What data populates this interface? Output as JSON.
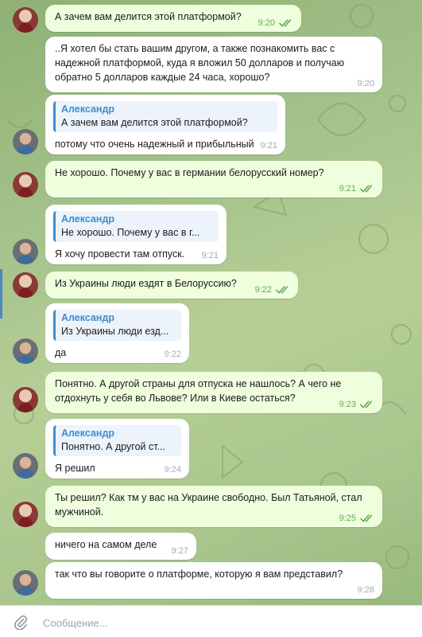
{
  "composer": {
    "placeholder": "Сообщение..."
  },
  "colors": {
    "accent": "#3d8ed0",
    "outgoing_bubble": "#effedd",
    "incoming_bubble": "#ffffff",
    "read_check": "#5fae53"
  },
  "messages": [
    {
      "direction": "out",
      "text": "А зачем вам делится этой платформой?",
      "time": "9:20",
      "status": "read"
    },
    {
      "direction": "in",
      "text": "..Я хотел бы стать вашим другом, а также познакомить вас с надежной платформой, куда я вложил 50 долларов и получаю обратно 5 долларов каждые 24 часа, хорошо?",
      "time": "9:20"
    },
    {
      "direction": "in",
      "reply_author": "Александр",
      "reply_text": "А зачем вам делится этой платформой?",
      "text": "потому что очень надежный и прибыльный",
      "time": "9:21"
    },
    {
      "direction": "out",
      "text": "Не хорошо. Почему у вас в германии белорусский номер?",
      "time": "9:21",
      "status": "read"
    },
    {
      "direction": "in",
      "reply_author": "Александр",
      "reply_text": "Не хорошо. Почему у вас в г...",
      "text": "Я хочу провести там отпуск.",
      "time": "9:21"
    },
    {
      "direction": "out",
      "text": "Из Украины люди ездят в Белоруссию?",
      "time": "9:22",
      "status": "read"
    },
    {
      "direction": "in",
      "reply_author": "Александр",
      "reply_text": "Из Украины люди езд...",
      "text": "да",
      "time": "9:22"
    },
    {
      "direction": "out",
      "text": "Понятно. А другой страны для отпуска не нашлось? А чего не отдохнуть у себя во Львове? Или в Киеве остаться?",
      "time": "9:23",
      "status": "read"
    },
    {
      "direction": "in",
      "reply_author": "Александр",
      "reply_text": "Понятно. А другой ст...",
      "text": "Я решил",
      "time": "9:24"
    },
    {
      "direction": "out",
      "text": "Ты решил? Как тм у вас на Украине свободно. Был Татьяной, стал мужчиной.",
      "time": "9:25",
      "status": "read"
    },
    {
      "direction": "in",
      "text": "ничего на самом деле",
      "time": "9:27"
    },
    {
      "direction": "in",
      "text": "так что вы говорите о платформе, которую я вам представил?",
      "time": "9:28"
    }
  ]
}
